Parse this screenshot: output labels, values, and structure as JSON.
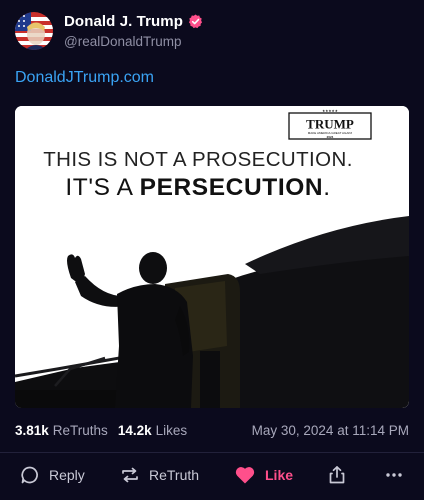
{
  "author": {
    "display_name": "Donald J. Trump",
    "handle": "@realDonaldTrump",
    "verified": true,
    "avatar_icon": "flag-portrait-avatar",
    "verified_icon": "verified-badge-icon"
  },
  "post": {
    "link_text": "DonaldJTrump.com",
    "media": {
      "logo_text": "TRUMP",
      "logo_tagline": "MAKE AMERICA GREAT AGAIN!",
      "logo_year": "2024",
      "headline_line1": "THIS IS NOT A PROSECUTION.",
      "headline_line2_prefix": "IT'S A ",
      "headline_line2_bold": "PERSECUTION",
      "headline_line2_suffix": "."
    }
  },
  "stats": {
    "retruths_count": "3.81k",
    "retruths_label": "ReTruths",
    "likes_count": "14.2k",
    "likes_label": "Likes",
    "timestamp": "May 30, 2024 at 11:14 PM"
  },
  "actions": {
    "reply_label": "Reply",
    "retruth_label": "ReTruth",
    "like_label": "Like",
    "share_icon": "share-icon",
    "more_icon": "more-options-icon"
  },
  "colors": {
    "background": "#0b0a1d",
    "link": "#3aa3f4",
    "like_active": "#ff4f8b",
    "verified_badge": "#ff4f8b",
    "muted_text": "#a8a8bb"
  }
}
